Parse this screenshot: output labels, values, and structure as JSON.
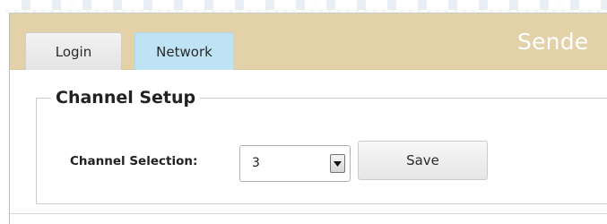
{
  "tabs": [
    {
      "label": "Login",
      "active": false
    },
    {
      "label": "Network",
      "active": true
    }
  ],
  "header": {
    "brand_title": "Sende"
  },
  "channel_setup": {
    "legend": "Channel Setup",
    "channel_label": "Channel Selection:",
    "selected_channel": "3",
    "save_label": "Save"
  },
  "colors": {
    "tab_bar": "#e3d2a8",
    "active_tab": "#bde3f4",
    "brand_text": "#ffffff"
  },
  "icons": {
    "select_arrow": "chevron-down-icon"
  }
}
